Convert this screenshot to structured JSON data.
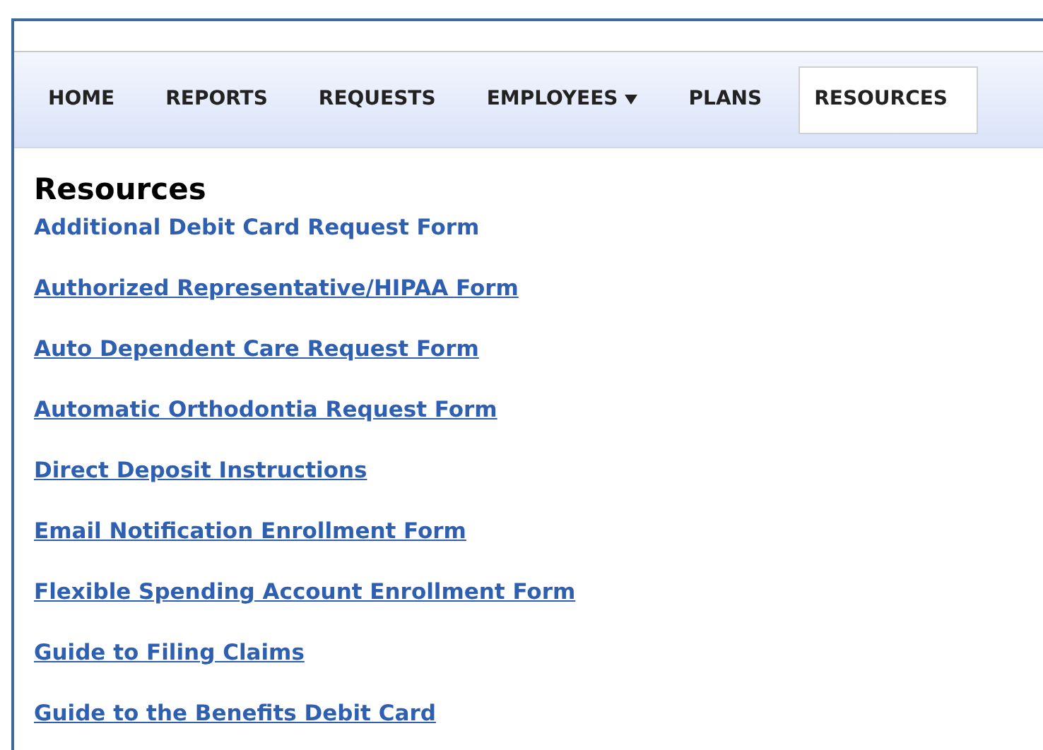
{
  "nav": [
    {
      "label": "HOME",
      "selected": false,
      "dropdown": false
    },
    {
      "label": "REPORTS",
      "selected": false,
      "dropdown": false
    },
    {
      "label": "REQUESTS",
      "selected": false,
      "dropdown": false
    },
    {
      "label": "EMPLOYEES",
      "selected": false,
      "dropdown": true
    },
    {
      "label": "PLANS",
      "selected": false,
      "dropdown": false
    },
    {
      "label": "RESOURCES",
      "selected": true,
      "dropdown": false
    }
  ],
  "heading": "Resources",
  "links": [
    {
      "label": "Additional Debit Card Request Form",
      "underlined": false
    },
    {
      "label": "Authorized Representative/HIPAA Form",
      "underlined": true
    },
    {
      "label": "Auto Dependent Care Request Form",
      "underlined": true
    },
    {
      "label": "Automatic Orthodontia Request Form",
      "underlined": true
    },
    {
      "label": "Direct Deposit Instructions",
      "underlined": true
    },
    {
      "label": "Email Notification Enrollment Form",
      "underlined": true
    },
    {
      "label": "Flexible Spending Account Enrollment Form",
      "underlined": true
    },
    {
      "label": "Guide to Filing Claims",
      "underlined": true
    },
    {
      "label": "Guide to the Benefits Debit Card",
      "underlined": true
    }
  ]
}
